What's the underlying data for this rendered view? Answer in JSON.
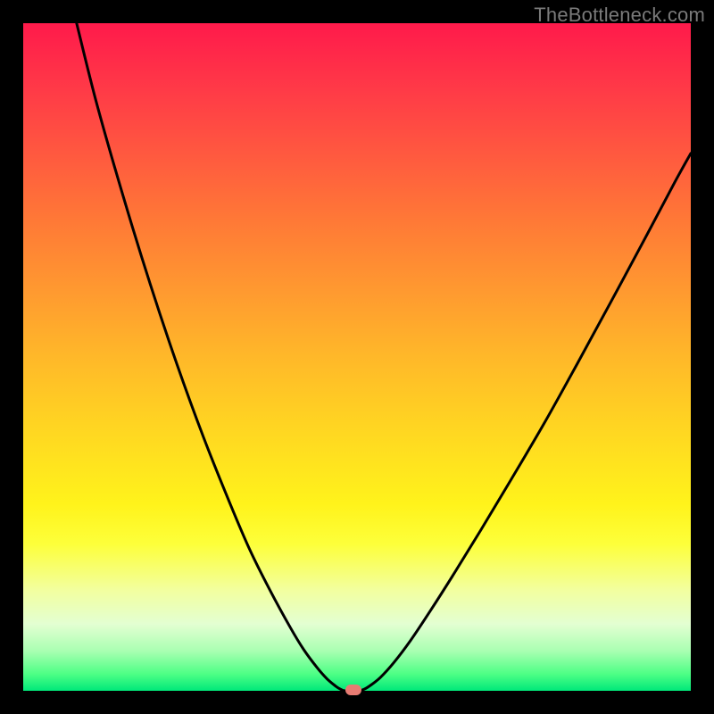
{
  "watermark": "TheBottleneck.com",
  "colors": {
    "frame": "#000000",
    "curve": "#000000",
    "marker": "#e77b72"
  },
  "chart_data": {
    "type": "line",
    "title": "",
    "xlabel": "",
    "ylabel": "",
    "x_range": [
      0,
      100
    ],
    "y_range": [
      0,
      100
    ],
    "curve_points_norm": [
      [
        0.08,
        0.0
      ],
      [
        0.11,
        0.12
      ],
      [
        0.15,
        0.26
      ],
      [
        0.19,
        0.39
      ],
      [
        0.23,
        0.51
      ],
      [
        0.27,
        0.62
      ],
      [
        0.31,
        0.72
      ],
      [
        0.34,
        0.79
      ],
      [
        0.37,
        0.85
      ],
      [
        0.4,
        0.905
      ],
      [
        0.42,
        0.938
      ],
      [
        0.44,
        0.965
      ],
      [
        0.455,
        0.982
      ],
      [
        0.468,
        0.993
      ],
      [
        0.476,
        0.998
      ],
      [
        0.482,
        1.0
      ],
      [
        0.5,
        1.0
      ],
      [
        0.51,
        0.998
      ],
      [
        0.52,
        0.992
      ],
      [
        0.535,
        0.98
      ],
      [
        0.555,
        0.958
      ],
      [
        0.58,
        0.925
      ],
      [
        0.61,
        0.88
      ],
      [
        0.645,
        0.825
      ],
      [
        0.685,
        0.76
      ],
      [
        0.73,
        0.685
      ],
      [
        0.78,
        0.6
      ],
      [
        0.83,
        0.51
      ],
      [
        0.88,
        0.418
      ],
      [
        0.93,
        0.325
      ],
      [
        0.975,
        0.24
      ],
      [
        1.0,
        0.195
      ]
    ],
    "marker_norm": [
      0.494,
      0.998
    ],
    "gradient_stops": [
      {
        "pos": 0.0,
        "color": "#ff1a4b"
      },
      {
        "pos": 0.5,
        "color": "#ffb829"
      },
      {
        "pos": 0.78,
        "color": "#fdff3a"
      },
      {
        "pos": 1.0,
        "color": "#00e87a"
      }
    ]
  }
}
